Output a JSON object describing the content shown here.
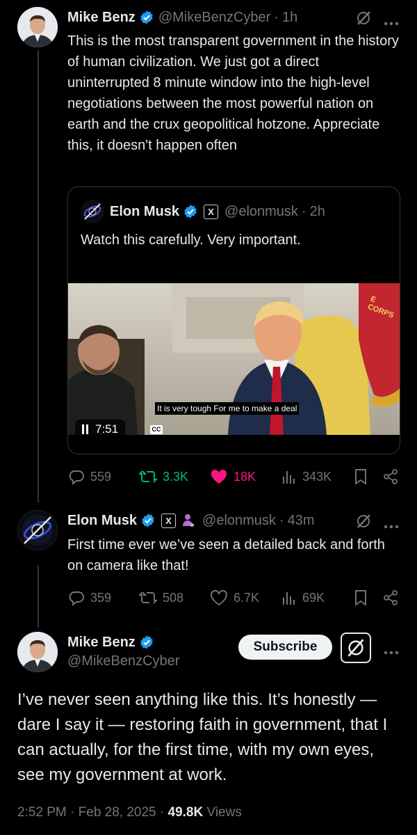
{
  "tweet1": {
    "name": "Mike Benz",
    "handle": "@MikeBenzCyber",
    "time": "1h",
    "text": "This is the most transparent government in the history of human civilization. We just got a direct uninterrupted 8 minute window into the high-level negotiations between the most powerful nation on earth and the crux geopolitical hotzone. Appreciate this, it doesn't happen often",
    "quote": {
      "name": "Elon Musk",
      "handle": "@elonmusk",
      "time": "2h",
      "text": "Watch this carefully. Very important.",
      "badge": "X",
      "video": {
        "caption": "It is very tough For me to make a deal",
        "duration": "7:51",
        "cc": "CC",
        "flag_text": "E CORPS"
      }
    },
    "stats": {
      "replies": "559",
      "reposts": "3.3K",
      "likes": "18K",
      "views": "343K"
    }
  },
  "tweet2": {
    "name": "Elon Musk",
    "handle": "@elonmusk",
    "time": "43m",
    "badge": "X",
    "text": "First time ever we’ve seen a detailed back and forth on camera like that!",
    "stats": {
      "replies": "359",
      "reposts": "508",
      "likes": "6.7K",
      "views": "69K"
    }
  },
  "main": {
    "name": "Mike Benz",
    "handle": "@MikeBenzCyber",
    "subscribe_label": "Subscribe",
    "text": "I’ve never seen anything like this. It’s honestly — dare I say it — restoring faith in government, that I can actually, for the first time, with my own eyes, see my government at work.",
    "timestamp": "2:52 PM · Feb 28, 2025 · ",
    "views_count": "49.8K",
    "views_label": " Views"
  },
  "separators": {
    "dot": "·"
  },
  "colors": {
    "verified": "#1d9bf0",
    "like_active": "#f91880",
    "muted": "#71767b",
    "repost": "#00ba7c"
  },
  "icons": [
    "grok-icon",
    "more-icon",
    "reply-icon",
    "repost-icon",
    "like-icon",
    "views-icon",
    "bookmark-icon",
    "share-icon",
    "verified-badge-icon",
    "x-badge-icon",
    "affiliate-icon",
    "pause-icon"
  ]
}
